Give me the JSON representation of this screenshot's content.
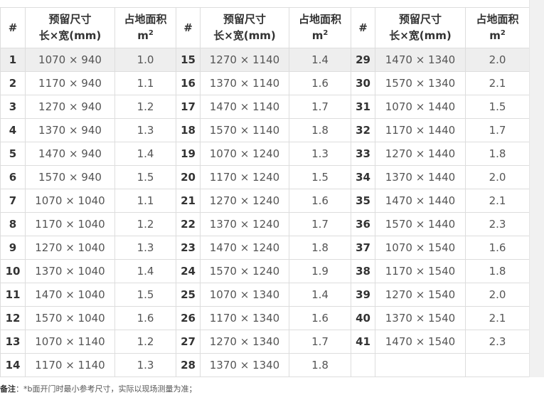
{
  "table": {
    "headers": {
      "index": "#",
      "size_line1": "预留尺寸",
      "size_line2": "长×宽(mm)",
      "area_line1": "占地面积",
      "area_unit": "m",
      "area_exp": "2"
    },
    "rows": [
      [
        {
          "n": "1",
          "size": "1070 × 940",
          "area": "1.0"
        },
        {
          "n": "15",
          "size": "1270 × 1140",
          "area": "1.4"
        },
        {
          "n": "29",
          "size": "1470 × 1340",
          "area": "2.0"
        }
      ],
      [
        {
          "n": "2",
          "size": "1170 × 940",
          "area": "1.1"
        },
        {
          "n": "16",
          "size": "1370 × 1140",
          "area": "1.6"
        },
        {
          "n": "30",
          "size": "1570 × 1340",
          "area": "2.1"
        }
      ],
      [
        {
          "n": "3",
          "size": "1270 × 940",
          "area": "1.2"
        },
        {
          "n": "17",
          "size": "1470 × 1140",
          "area": "1.7"
        },
        {
          "n": "31",
          "size": "1070 × 1440",
          "area": "1.5"
        }
      ],
      [
        {
          "n": "4",
          "size": "1370 × 940",
          "area": "1.3"
        },
        {
          "n": "18",
          "size": "1570 × 1140",
          "area": "1.8"
        },
        {
          "n": "32",
          "size": "1170 × 1440",
          "area": "1.7"
        }
      ],
      [
        {
          "n": "5",
          "size": "1470 × 940",
          "area": "1.4"
        },
        {
          "n": "19",
          "size": "1070 × 1240",
          "area": "1.3"
        },
        {
          "n": "33",
          "size": "1270 × 1440",
          "area": "1.8"
        }
      ],
      [
        {
          "n": "6",
          "size": "1570 × 940",
          "area": "1.5"
        },
        {
          "n": "20",
          "size": "1170 × 1240",
          "area": "1.5"
        },
        {
          "n": "34",
          "size": "1370 × 1440",
          "area": "2.0"
        }
      ],
      [
        {
          "n": "7",
          "size": "1070 × 1040",
          "area": "1.1"
        },
        {
          "n": "21",
          "size": "1270 × 1240",
          "area": "1.6"
        },
        {
          "n": "35",
          "size": "1470 × 1440",
          "area": "2.1"
        }
      ],
      [
        {
          "n": "8",
          "size": "1170 × 1040",
          "area": "1.2"
        },
        {
          "n": "22",
          "size": "1370 × 1240",
          "area": "1.7"
        },
        {
          "n": "36",
          "size": "1570 × 1440",
          "area": "2.3"
        }
      ],
      [
        {
          "n": "9",
          "size": "1270 × 1040",
          "area": "1.3"
        },
        {
          "n": "23",
          "size": "1470 × 1240",
          "area": "1.8"
        },
        {
          "n": "37",
          "size": "1070 × 1540",
          "area": "1.6"
        }
      ],
      [
        {
          "n": "10",
          "size": "1370 × 1040",
          "area": "1.4"
        },
        {
          "n": "24",
          "size": "1570 × 1240",
          "area": "1.9"
        },
        {
          "n": "38",
          "size": "1170 × 1540",
          "area": "1.8"
        }
      ],
      [
        {
          "n": "11",
          "size": "1470 × 1040",
          "area": "1.5"
        },
        {
          "n": "25",
          "size": "1070 × 1340",
          "area": "1.4"
        },
        {
          "n": "39",
          "size": "1270 × 1540",
          "area": "2.0"
        }
      ],
      [
        {
          "n": "12",
          "size": "1570 × 1040",
          "area": "1.6"
        },
        {
          "n": "26",
          "size": "1170 × 1340",
          "area": "1.6"
        },
        {
          "n": "40",
          "size": "1370 × 1540",
          "area": "2.1"
        }
      ],
      [
        {
          "n": "13",
          "size": "1070 × 1140",
          "area": "1.2"
        },
        {
          "n": "27",
          "size": "1270 × 1340",
          "area": "1.7"
        },
        {
          "n": "41",
          "size": "1470 × 1540",
          "area": "2.3"
        }
      ],
      [
        {
          "n": "14",
          "size": "1170 × 1140",
          "area": "1.3"
        },
        {
          "n": "28",
          "size": "1370 × 1340",
          "area": "1.8"
        },
        {
          "n": "",
          "size": "",
          "area": ""
        }
      ]
    ]
  },
  "note": {
    "label": "备注",
    "text": "：*b面开门时最小参考尺寸，实际以现场测量为准；"
  }
}
